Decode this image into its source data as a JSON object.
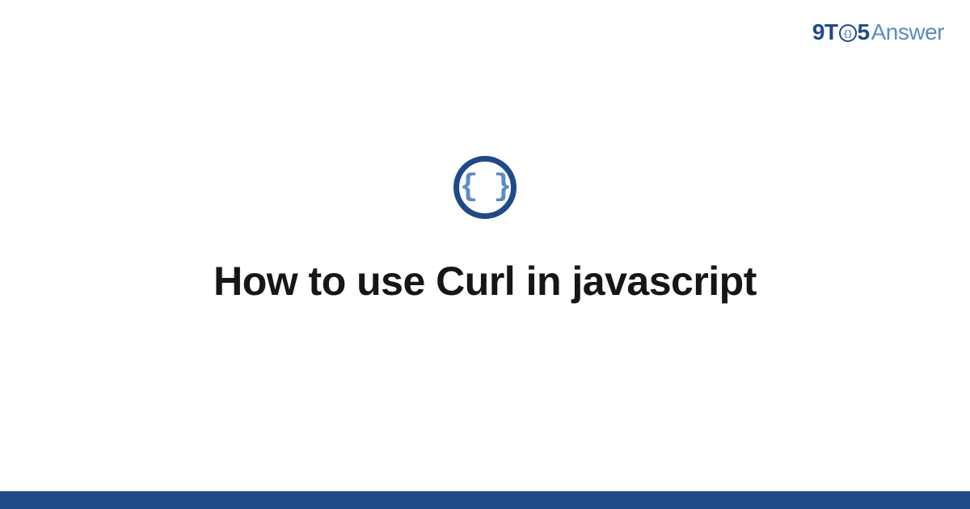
{
  "brand": {
    "prefix_9t": "9T",
    "circle_content": "{}",
    "five": "5",
    "answer": "Answer"
  },
  "icon": {
    "name": "code-braces-icon",
    "glyph": "{ }"
  },
  "title": "How to use Curl in javascript",
  "colors": {
    "primary": "#1e4a8a",
    "accent": "#5a8bc9",
    "text": "#161616",
    "background": "#ffffff"
  }
}
